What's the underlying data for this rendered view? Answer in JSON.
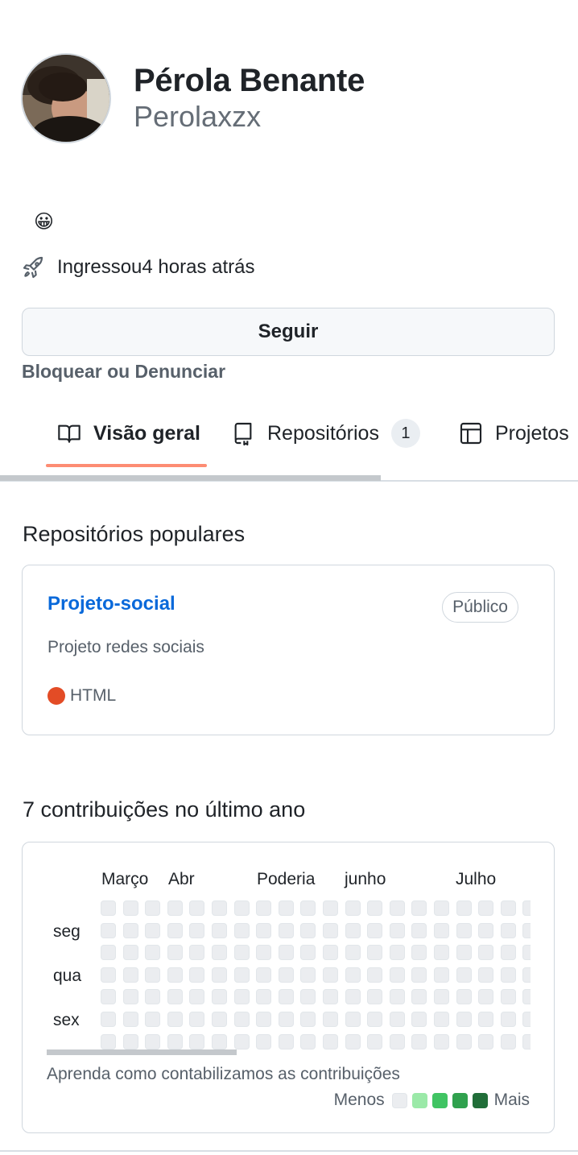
{
  "profile": {
    "full_name": "Pérola Benante",
    "username": "Perolaxzx",
    "status_emoji": "😀",
    "joined_text": "Ingressou4 horas atrás",
    "follow_label": "Seguir",
    "block_label": "Bloquear ou Denunciar"
  },
  "tabs": {
    "overview": "Visão geral",
    "repositories": "Repositórios",
    "repositories_count": "1",
    "projects": "Projetos"
  },
  "popular": {
    "title": "Repositórios populares",
    "repo": {
      "name": "Projeto-social",
      "visibility": "Público",
      "description": "Projeto redes sociais",
      "language": "HTML",
      "language_color": "#e34c26"
    }
  },
  "contributions": {
    "title": "7 contribuições no último ano",
    "months": [
      "Março",
      "Abr",
      "Poderia",
      "junho",
      "Julho"
    ],
    "days": [
      "seg",
      "qua",
      "sex"
    ],
    "learn_text": "Aprenda como contabilizamos as contribuições",
    "legend_less": "Menos",
    "legend_more": "Mais",
    "legend_colors": [
      "#ebedf0",
      "#9be9a8",
      "#40c463",
      "#30a14e",
      "#216e39"
    ],
    "empty_cell_color": "#ebedf0"
  }
}
